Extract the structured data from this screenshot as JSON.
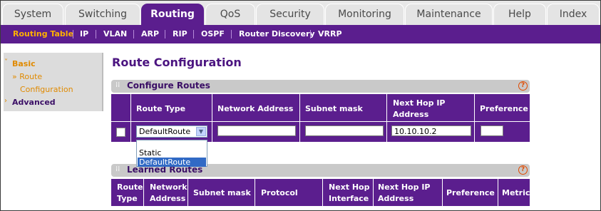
{
  "tabs": [
    "System",
    "Switching",
    "Routing",
    "QoS",
    "Security",
    "Monitoring",
    "Maintenance",
    "Help",
    "Index"
  ],
  "active_tab": "Routing",
  "submenu": [
    "Routing Table",
    "IP",
    "VLAN",
    "ARP",
    "RIP",
    "OSPF",
    "Router Discovery",
    "VRRP"
  ],
  "active_submenu": "Routing Table",
  "leftnav": {
    "basic": "Basic",
    "route": "» Route",
    "configuration": "Configuration",
    "advanced": "Advanced"
  },
  "page_title": "Route Configuration",
  "configure": {
    "header": "Configure Routes",
    "help": "?",
    "columns": [
      "Route Type",
      "Network Address",
      "Subnet mask",
      "Next Hop IP",
      "Address",
      "Preference"
    ],
    "row": {
      "route_type": "DefaultRoute",
      "network_address": "",
      "subnet_mask": "",
      "next_hop": "10.10.10.2",
      "preference": ""
    },
    "route_type_options": [
      "Static",
      "DefaultRoute"
    ],
    "highlighted_option": "DefaultRoute"
  },
  "learned": {
    "header": "Learned Routes",
    "help": "?",
    "columns": {
      "route_type_1": "Route",
      "route_type_2": "Type",
      "network_1": "Network",
      "network_2": "Address",
      "subnet": "Subnet mask",
      "protocol": "Protocol",
      "nhi_1": "Next Hop",
      "nhi_2": "Interface",
      "nhip_1": "Next Hop IP",
      "nhip_2": "Address",
      "preference": "Preference",
      "metric": "Metric"
    }
  },
  "colors": {
    "accent": "#5b1e8e",
    "active_text": "#ffb000",
    "section_bg": "#c9c9c9"
  }
}
